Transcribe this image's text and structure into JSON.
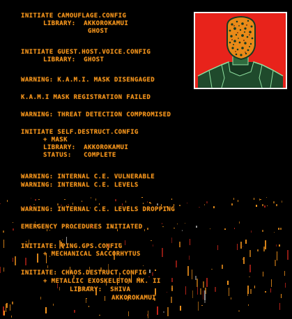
{
  "terminal": {
    "lines": [
      "INITIATE CAMOUFLAGE.CONFIG",
      "LIBRARY:  AKKOROKAMUI",
      "GHOST",
      "INITIATE GUEST.HOST.VOICE.CONFIG",
      "LIBRARY:  GHOST",
      "WARNING: K.A.M.I. MASK DISENGAGED",
      "K.A.M.I MASK REGISTRATION FAILED",
      "WARNING: THREAT DETECTION COMPROMISED",
      "INITIATE SELF.DESTRUCT.CONFIG",
      "+ MASK",
      "LIBRARY:  AKKOROKAMUI",
      "STATUS:   COMPLETE",
      "WARNING: INTERNAL C.E. VULNERABLE",
      "WARNING: INTERNAL C.E. LEVELS",
      "WARNING: INTERNAL C.E. LEVELS DROPPING",
      "EMERGENCY PROCEDURES INITIATED",
      "INITIATE: PING.GPS.CONFIG",
      "+ MECHANICAL SACCORHYTUS",
      "INITIATE: CHAOS.DESTRUCT.CONFIG",
      "+ METALLIC EXOSKELETON MK. II",
      "LIBRARY:  SHIVA",
      "AKKOROKAMUI"
    ]
  },
  "colors": {
    "text": "#f3941c",
    "portrait_bg": "#e8231b",
    "portrait_frame": "#f3f3f3",
    "portrait_body": "#1f4a2c",
    "portrait_outline": "#8fe0a0",
    "background": "#000000"
  },
  "icons": {
    "portrait": "masked-soldier-portrait"
  }
}
